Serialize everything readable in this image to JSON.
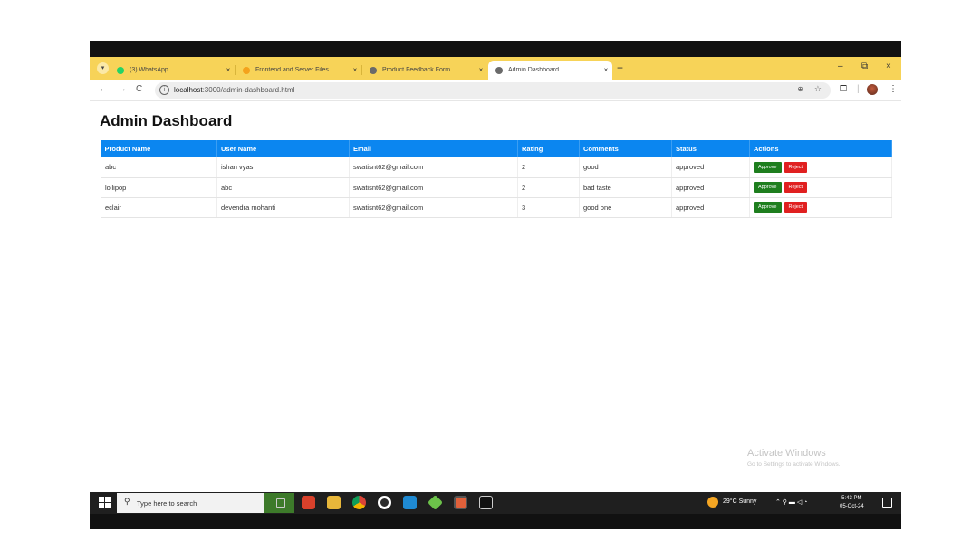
{
  "browser": {
    "tabs": [
      {
        "label": "(3) WhatsApp",
        "active": false,
        "favicon_color": "#25D366"
      },
      {
        "label": "Frontend and Server Files",
        "active": false,
        "favicon_color": "#f4a21c"
      },
      {
        "label": "Product Feedback Form",
        "active": false,
        "favicon_color": "#6a6a6a"
      },
      {
        "label": "Admin Dashboard",
        "active": true,
        "favicon_color": "#6a6a6a"
      }
    ],
    "close_glyph": "×",
    "new_tab_glyph": "+",
    "url_host": "localhost",
    "url_path": ":3000/admin-dashboard.html",
    "window_controls": {
      "minimize": "–",
      "restore": "⧉",
      "close": "×"
    },
    "icons": [
      "back-icon",
      "forward-icon",
      "reload-icon",
      "site-info-icon",
      "zoom-icon",
      "bookmark-star-icon",
      "extensions-icon",
      "profile-avatar",
      "menu-icon"
    ]
  },
  "page": {
    "title": "Admin Dashboard",
    "columns": [
      "Product Name",
      "User Name",
      "Email",
      "Rating",
      "Comments",
      "Status",
      "Actions"
    ],
    "rows": [
      {
        "product": "abc",
        "user": "ishan vyas",
        "email": "swatisnt62@gmail.com",
        "rating": "2",
        "comments": "good",
        "status": "approved"
      },
      {
        "product": "lollipop",
        "user": "abc",
        "email": "swatisnt62@gmail.com",
        "rating": "2",
        "comments": "bad taste",
        "status": "approved"
      },
      {
        "product": "eclair",
        "user": "devendra mohanti",
        "email": "swatisnt62@gmail.com",
        "rating": "3",
        "comments": "good one",
        "status": "approved"
      }
    ],
    "approve_label": "Approve",
    "reject_label": "Reject",
    "approve_color": "#1e7e1e",
    "reject_color": "#e02020",
    "header_color": "#0b86f0"
  },
  "watermark": {
    "line1": "Activate Windows",
    "line2": "Go to Settings to activate Windows."
  },
  "taskbar": {
    "search_placeholder": "Type here to search",
    "weather": "29°C Sunny",
    "time": "5:43 PM",
    "date": "05-Oct-24",
    "apps": [
      "task-view-icon",
      "news-app-icon",
      "file-explorer-icon",
      "chrome-icon",
      "obs-icon",
      "vscode-icon",
      "nodejs-icon",
      "git-icon",
      "terminal-icon"
    ]
  }
}
